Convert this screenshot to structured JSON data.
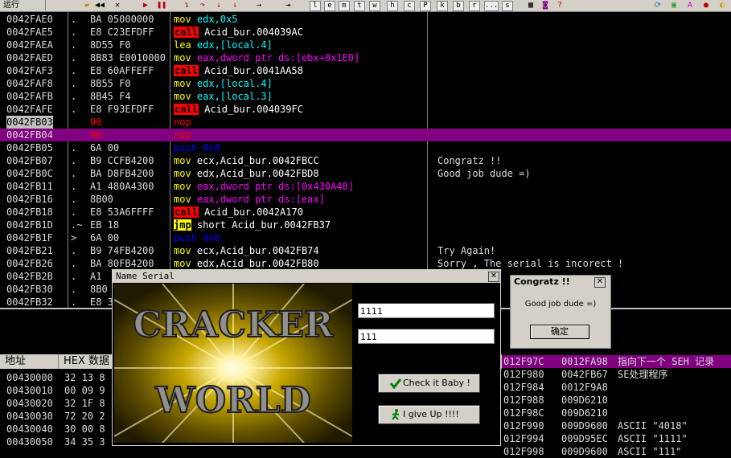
{
  "toolbar": {
    "status": "运行",
    "letter_buttons": [
      "l",
      "e",
      "m",
      "t",
      "w",
      "h",
      "c",
      "P",
      "k",
      "b",
      "r",
      "...",
      "s"
    ]
  },
  "disasm": {
    "rows": [
      {
        "addr": "0042FAE0",
        "mark": ".",
        "hex": "BA 05000000",
        "asm": "mov edx,0x5",
        "cmt": ""
      },
      {
        "addr": "0042FAE5",
        "mark": ".",
        "hex": "E8 C23EFDFF",
        "asm": "call Acid_bur.004039AC",
        "cmt": ""
      },
      {
        "addr": "0042FAEA",
        "mark": ".",
        "hex": "8D55 F0",
        "asm": "lea edx,[local.4]",
        "cmt": ""
      },
      {
        "addr": "0042FAED",
        "mark": ".",
        "hex": "8B83 E0010000",
        "asm": "mov eax,dword ptr ds:[ebx+0x1E0]",
        "cmt": ""
      },
      {
        "addr": "0042FAF3",
        "mark": ".",
        "hex": "E8 60AFFEFF",
        "asm": "call Acid_bur.0041AA58",
        "cmt": ""
      },
      {
        "addr": "0042FAF8",
        "mark": ".",
        "hex": "8B55 F0",
        "asm": "mov edx,[local.4]",
        "cmt": ""
      },
      {
        "addr": "0042FAFB",
        "mark": ".",
        "hex": "8B45 F4",
        "asm": "mov eax,[local.3]",
        "cmt": ""
      },
      {
        "addr": "0042FAFE",
        "mark": ".",
        "hex": "E8 F93EFDFF",
        "asm": "call Acid_bur.004039FC",
        "cmt": ""
      },
      {
        "addr": "0042FB03",
        "mark": "",
        "hex": "90",
        "asm": "nop",
        "cmt": ""
      },
      {
        "addr": "0042FB04",
        "mark": "",
        "hex": "90",
        "asm": "nop",
        "cmt": ""
      },
      {
        "addr": "0042FB05",
        "mark": ".",
        "hex": "6A 00",
        "asm": "push 0x0",
        "cmt": ""
      },
      {
        "addr": "0042FB07",
        "mark": ".",
        "hex": "B9 CCFB4200",
        "asm": "mov ecx,Acid_bur.0042FBCC",
        "cmt": "Congratz !!"
      },
      {
        "addr": "0042FB0C",
        "mark": ".",
        "hex": "BA D8FB4200",
        "asm": "mov edx,Acid_bur.0042FBD8",
        "cmt": "Good job dude =)"
      },
      {
        "addr": "0042FB11",
        "mark": ".",
        "hex": "A1 480A4300",
        "asm": "mov eax,dword ptr ds:[0x430A48]",
        "cmt": ""
      },
      {
        "addr": "0042FB16",
        "mark": ".",
        "hex": "8B00",
        "asm": "mov eax,dword ptr ds:[eax]",
        "cmt": ""
      },
      {
        "addr": "0042FB18",
        "mark": ".",
        "hex": "E8 53A6FFFF",
        "asm": "call Acid_bur.0042A170",
        "cmt": ""
      },
      {
        "addr": "0042FB1D",
        "mark": ".~",
        "hex": "EB 18",
        "asm": "jmp short Acid_bur.0042FB37",
        "cmt": ""
      },
      {
        "addr": "0042FB1F",
        "mark": ">",
        "hex": "6A 00",
        "asm": "push 0x0",
        "cmt": ""
      },
      {
        "addr": "0042FB21",
        "mark": ".",
        "hex": "B9 74FB4200",
        "asm": "mov ecx,Acid_bur.0042FB74",
        "cmt": "Try Again!"
      },
      {
        "addr": "0042FB26",
        "mark": ".",
        "hex": "BA 80FB4200",
        "asm": "mov edx,Acid_bur.0042FB80",
        "cmt": "Sorry , The serial is incorect !"
      },
      {
        "addr": "0042FB2B",
        "mark": ".",
        "hex": "A1 ",
        "asm": "",
        "cmt": ""
      },
      {
        "addr": "0042FB30",
        "mark": ".",
        "hex": "8B0",
        "asm": "",
        "cmt": ""
      },
      {
        "addr": "0042FB32",
        "mark": ".",
        "hex": "E8 3",
        "asm": "",
        "cmt": ""
      }
    ]
  },
  "dump": {
    "header_addr": "地址",
    "header_hex": "HEX 数据",
    "rows": [
      {
        "addr": "00430000",
        "hex": "32 13 8"
      },
      {
        "addr": "00430010",
        "hex": "00 09 9"
      },
      {
        "addr": "00430020",
        "hex": "32 1F 8"
      },
      {
        "addr": "00430030",
        "hex": "72 20 2"
      },
      {
        "addr": "00430040",
        "hex": "30 00 8"
      },
      {
        "addr": "00430050",
        "hex": "34 35 3"
      }
    ]
  },
  "stack": {
    "rows": [
      {
        "addr": "012F97C",
        "val": "0012FA98",
        "cmt": "指向下一个 SEH 记录"
      },
      {
        "addr": "012F980",
        "val": "0042FB67",
        "cmt": "SE处理程序"
      },
      {
        "addr": "012F984",
        "val": "0012F9A8",
        "cmt": ""
      },
      {
        "addr": "012F988",
        "val": "009D6210",
        "cmt": ""
      },
      {
        "addr": "012F98C",
        "val": "009D6210",
        "cmt": ""
      },
      {
        "addr": "012F990",
        "val": "009D9600",
        "cmt": "ASCII \"4018\""
      },
      {
        "addr": "012F994",
        "val": "009D95EC",
        "cmt": "ASCII \"1111\""
      },
      {
        "addr": "012F998",
        "val": "009D9600",
        "cmt": "ASCII \"111\""
      }
    ]
  },
  "name_dialog": {
    "title": "Name Serial",
    "logo_line1": "CRACKER",
    "logo_line2": "WORLD",
    "name_value": "1111",
    "serial_value": "111",
    "check_button": "Check it Baby !",
    "giveup_button": "I give Up !!!!"
  },
  "congratz_dialog": {
    "title": "Congratz !!",
    "message": "Good job dude =)",
    "ok_button": "确定"
  },
  "colors": {
    "selection": "#800080",
    "call_bg": "#ff0000",
    "mov": "#ffff00",
    "push": "#0000ff"
  }
}
